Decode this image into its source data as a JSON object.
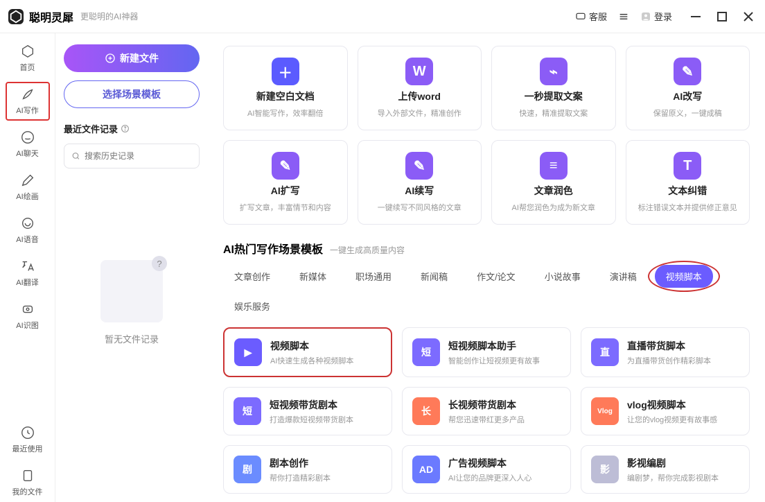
{
  "header": {
    "title": "聪明灵犀",
    "subtitle": "更聪明的AI神器",
    "support": "客服",
    "login": "登录"
  },
  "sidebar": {
    "items": [
      {
        "label": "首页"
      },
      {
        "label": "AI写作"
      },
      {
        "label": "AI聊天"
      },
      {
        "label": "AI绘画"
      },
      {
        "label": "AI语音"
      },
      {
        "label": "AI翻译"
      },
      {
        "label": "AI识图"
      },
      {
        "label": "最近使用"
      },
      {
        "label": "我的文件"
      }
    ]
  },
  "left": {
    "new_file": "新建文件",
    "choose_template": "选择场景模板",
    "recent_title": "最近文件记录",
    "search_placeholder": "搜索历史记录",
    "empty_text": "暂无文件记录"
  },
  "actions": [
    {
      "title": "新建空白文档",
      "desc": "AI智能写作，效率翻倍",
      "color": "#5b5bff"
    },
    {
      "title": "上传word",
      "desc": "导入外部文件，精准创作",
      "color": "#8b5cf6"
    },
    {
      "title": "一秒提取文案",
      "desc": "快速，精准提取文案",
      "color": "#8b5cf6"
    },
    {
      "title": "AI改写",
      "desc": "保留原义，一键成稿",
      "color": "#8b5cf6"
    },
    {
      "title": "AI扩写",
      "desc": "扩写文章，丰富情节和内容",
      "color": "#8b5cf6"
    },
    {
      "title": "AI续写",
      "desc": "一键续写不同风格的文章",
      "color": "#8b5cf6"
    },
    {
      "title": "文章润色",
      "desc": "AI帮您润色为成为新文章",
      "color": "#8b5cf6"
    },
    {
      "title": "文本纠错",
      "desc": "标注错误文本并提供修正意见",
      "color": "#8b5cf6"
    }
  ],
  "section": {
    "title": "AI热门写作场景模板",
    "subtitle": "一键生成高质量内容"
  },
  "tabs": [
    "文章创作",
    "新媒体",
    "职场通用",
    "新闻稿",
    "作文/论文",
    "小说故事",
    "演讲稿",
    "视频脚本",
    "娱乐服务"
  ],
  "active_tab": 7,
  "templates": [
    {
      "title": "视频脚本",
      "desc": "AI快速生成各种视频脚本",
      "highlight": true,
      "bg": "#6b5cff",
      "glyph": "▶"
    },
    {
      "title": "短视频脚本助手",
      "desc": "智能创作让短视频更有故事",
      "bg": "#7c6bff",
      "glyph": "短"
    },
    {
      "title": "直播带货脚本",
      "desc": "为直播带货创作精彩脚本",
      "bg": "#7c6bff",
      "glyph": "直"
    },
    {
      "title": "短视频带货剧本",
      "desc": "打造爆款短视频带货剧本",
      "bg": "#7c6bff",
      "glyph": "短"
    },
    {
      "title": "长视频带货剧本",
      "desc": "帮您迅速带红更多产品",
      "bg": "#ff7a59",
      "glyph": "长"
    },
    {
      "title": "vlog视频脚本",
      "desc": "让您的vlog视频更有故事感",
      "bg": "#ff7a59",
      "glyph": "Vlog"
    },
    {
      "title": "剧本创作",
      "desc": "帮你打造精彩剧本",
      "bg": "#6b8cff",
      "glyph": "剧"
    },
    {
      "title": "广告视频脚本",
      "desc": "AI让您的品牌更深入人心",
      "bg": "#6b7aff",
      "glyph": "AD"
    },
    {
      "title": "影视编剧",
      "desc": "编剧梦，帮你完成影视剧本",
      "bg": "#bdbdd6",
      "glyph": "影"
    }
  ]
}
